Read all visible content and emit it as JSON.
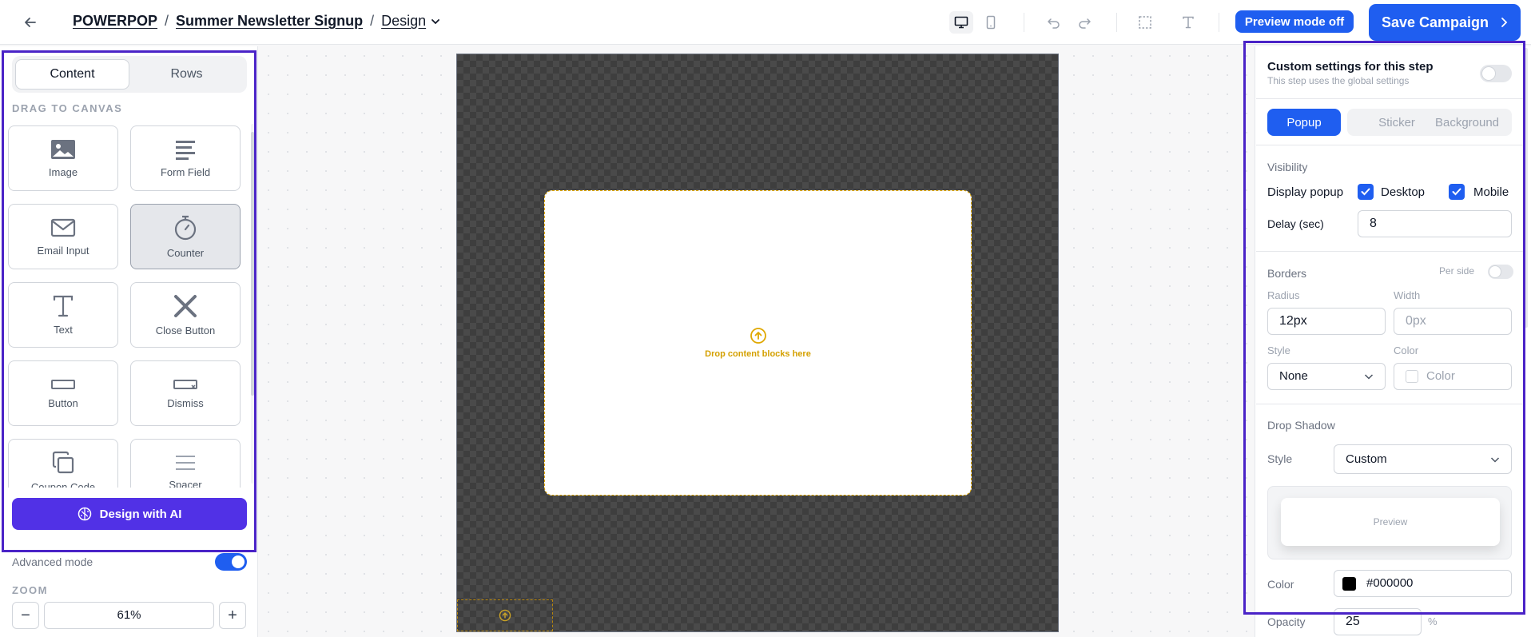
{
  "header": {
    "breadcrumb": {
      "brand": "POWERPOP",
      "campaign": "Summer Newsletter Signup",
      "page": "Design",
      "sep1": "/",
      "sep2": "/"
    },
    "preview_mode_label": "Preview mode off",
    "save_label": "Save Campaign",
    "icons": [
      "back-arrow-icon",
      "desktop-icon",
      "mobile-icon",
      "undo-icon",
      "redo-icon",
      "select-icon",
      "text-icon"
    ]
  },
  "left": {
    "tabs": [
      {
        "label": "Content",
        "active": true
      },
      {
        "label": "Rows",
        "active": false
      }
    ],
    "drag_label": "DRAG TO CANVAS",
    "blocks": [
      {
        "label": "Image",
        "icon": "image-icon"
      },
      {
        "label": "Form Field",
        "icon": "form-field-icon"
      },
      {
        "label": "Email Input",
        "icon": "email-icon"
      },
      {
        "label": "Counter",
        "icon": "timer-icon"
      },
      {
        "label": "Text",
        "icon": "text-icon"
      },
      {
        "label": "Close Button",
        "icon": "close-icon"
      },
      {
        "label": "Button",
        "icon": "button-icon"
      },
      {
        "label": "Dismiss",
        "icon": "dismiss-icon"
      },
      {
        "label": "Coupon Code",
        "icon": "copy-icon"
      },
      {
        "label": "Spacer",
        "icon": "spacer-icon"
      }
    ],
    "ai_button": "Design with AI",
    "advanced_mode": {
      "label": "Advanced mode",
      "on": true
    },
    "zoom": {
      "label": "ZOOM",
      "value": "61%",
      "minus": "−",
      "plus": "+"
    }
  },
  "canvas": {
    "drop_text": "Drop content blocks here"
  },
  "right": {
    "custom_title": "Custom settings for this step",
    "custom_sub": "This step uses the global settings",
    "tabs": [
      {
        "label": "Popup",
        "active": true
      },
      {
        "label": "Sticker",
        "active": false
      },
      {
        "label": "Background",
        "active": false
      }
    ],
    "visibility": {
      "section": "Visibility",
      "display_label": "Display popup",
      "desktop": "Desktop",
      "mobile": "Mobile",
      "delay_label": "Delay (sec)",
      "delay_value": "8"
    },
    "borders": {
      "section": "Borders",
      "per_side": "Per side",
      "radius_label": "Radius",
      "radius_value": "12px",
      "width_label": "Width",
      "width_placeholder": "0px",
      "style_label": "Style",
      "style_value": "None",
      "color_label": "Color",
      "color_placeholder": "Color"
    },
    "shadow": {
      "section": "Drop Shadow",
      "style_label": "Style",
      "style_value": "Custom",
      "preview": "Preview",
      "color_label": "Color",
      "color_value": "#000000",
      "opacity_label": "Opacity",
      "opacity_value": "25",
      "opacity_unit": "%"
    }
  },
  "colors": {
    "accent": "#1f5ef0",
    "ai": "#5131e6",
    "drop": "#e0a800",
    "outline": "#4a23c7"
  }
}
